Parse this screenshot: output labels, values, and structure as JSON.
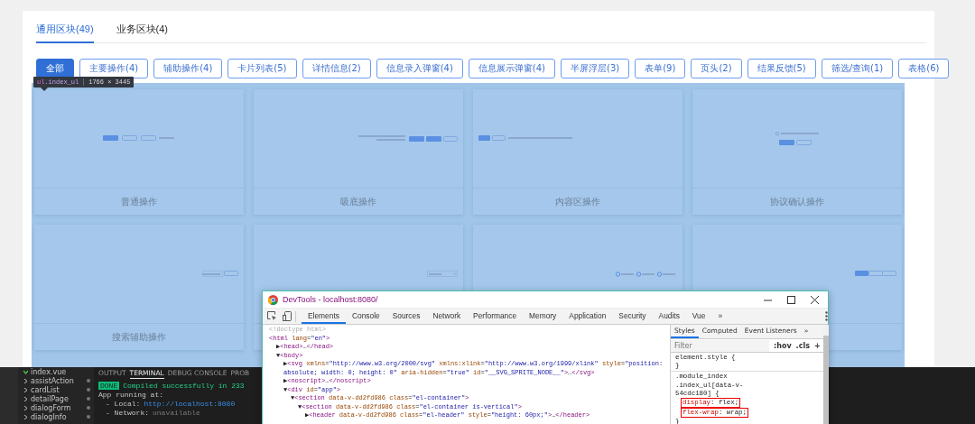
{
  "page_tabs": [
    {
      "label": "通用区块(49)",
      "selected": true
    },
    {
      "label": "业务区块(4)",
      "selected": false
    }
  ],
  "filters": [
    {
      "label": "全部",
      "selected": true
    },
    {
      "label": "主要操作(4)",
      "selected": false
    },
    {
      "label": "辅助操作(4)",
      "selected": false
    },
    {
      "label": "卡片列表(5)",
      "selected": false
    },
    {
      "label": "详情信息(2)",
      "selected": false
    },
    {
      "label": "信息录入弹窗(4)",
      "selected": false
    },
    {
      "label": "信息展示弹窗(4)",
      "selected": false
    },
    {
      "label": "半屏浮层(3)",
      "selected": false
    },
    {
      "label": "表单(9)",
      "selected": false
    },
    {
      "label": "页头(2)",
      "selected": false
    },
    {
      "label": "结果反馈(5)",
      "selected": false
    },
    {
      "label": "筛选/查询(1)",
      "selected": false
    },
    {
      "label": "表格(6)",
      "selected": false
    }
  ],
  "inspect_tooltip": {
    "tag": "ul",
    "class_name": ".index_ul",
    "size": "1766 × 3445"
  },
  "blocks": [
    {
      "kind": "actions",
      "title": "普通操作"
    },
    {
      "kind": "bottom",
      "title": "吸底操作"
    },
    {
      "kind": "inline",
      "title": "内容区操作"
    },
    {
      "kind": "agree",
      "title": "协议确认操作"
    },
    {
      "kind": "search",
      "title": "搜索辅助操作"
    },
    {
      "kind": "select"
    },
    {
      "kind": "radios"
    },
    {
      "kind": "segmented"
    }
  ],
  "editor": {
    "explorer": [
      {
        "kind": "file",
        "label": "index.vue"
      },
      {
        "kind": "folder",
        "label": "assistAction"
      },
      {
        "kind": "folder",
        "label": "cardList"
      },
      {
        "kind": "folder",
        "label": "detailPage"
      },
      {
        "kind": "folder",
        "label": "dialogForm"
      },
      {
        "kind": "folder",
        "label": "dialogInfo"
      }
    ],
    "panel_tabs": [
      {
        "label": "OUTPUT",
        "selected": false
      },
      {
        "label": "TERMINAL",
        "selected": true
      },
      {
        "label": "DEBUG CONSOLE",
        "selected": false
      },
      {
        "label": "PROB",
        "selected": false
      }
    ],
    "terminal": [
      {
        "kind": "badge",
        "badge": "DONE",
        "text": "Compiled successfully in 233"
      },
      {
        "kind": "text",
        "text": "App running at:"
      },
      {
        "kind": "link",
        "label": "- Local:",
        "value": "http://localhost:8080"
      },
      {
        "kind": "muted",
        "label": "- Network:",
        "value": "unavailable"
      }
    ]
  },
  "devtools": {
    "title": "DevTools - localhost:8080/",
    "tabs": [
      {
        "label": "Elements",
        "selected": true
      },
      {
        "label": "Console",
        "selected": false
      },
      {
        "label": "Sources",
        "selected": false
      },
      {
        "label": "Network",
        "selected": false
      },
      {
        "label": "Performance",
        "selected": false
      },
      {
        "label": "Memory",
        "selected": false
      },
      {
        "label": "Application",
        "selected": false
      },
      {
        "label": "Security",
        "selected": false
      },
      {
        "label": "Audits",
        "selected": false
      },
      {
        "label": "Vue",
        "selected": false
      }
    ],
    "more_tabs": "»",
    "dom": [
      {
        "kind": "doctype",
        "text": "<!doctype html>"
      },
      {
        "kind": "element",
        "text": "<html lang=\"en\">",
        "children": [
          {
            "kind": "element",
            "text": "▶<head>…</head>"
          },
          {
            "kind": "element",
            "text": "▼<body>",
            "children": [
              {
                "kind": "element",
                "text": "▶<svg xmlns=\"http://www.w3.org/2000/svg\" xmlns:xlink=\"http://www.w3.org/1999/xlink\" style=\"position: absolute; width: 0; height: 0\" aria-hidden=\"true\" id=\"__SVG_SPRITE_NODE__\">…</svg>"
              },
              {
                "kind": "element",
                "text": "▶<noscript>…</noscript>"
              },
              {
                "kind": "element",
                "text": "▼<div id=\"app\">",
                "children": [
                  {
                    "kind": "element",
                    "text": "▼<section data-v-dd2fd986 class=\"el-container\">",
                    "children": [
                      {
                        "kind": "element",
                        "text": "▼<section data-v-dd2fd986 class=\"el-container is-vertical\">",
                        "children": [
                          {
                            "kind": "element",
                            "text": "▶<header data-v-dd2fd986 class=\"el-header\" style=\"height: 60px;\">…</header>"
                          }
                        ]
                      }
                    ]
                  }
                ]
              }
            ]
          }
        ]
      }
    ],
    "style_tabs": [
      {
        "label": "Styles",
        "selected": true
      },
      {
        "label": "Computed",
        "selected": false
      },
      {
        "label": "Event Listeners",
        "selected": false
      }
    ],
    "style_more": "»",
    "filter": {
      "placeholder": "Filter"
    },
    "style_buttons": [
      ":hov",
      ".cls",
      "+"
    ],
    "style_rules": [
      {
        "selector": "element.style {",
        "close": "}"
      },
      {
        "selector": ".module_index .index_ul[data-v-54cdc180] {",
        "declarations": [
          {
            "property": "display",
            "value": ": flex;",
            "highlighted": true
          },
          {
            "property": "flex-wrap",
            "value": ": wrap;",
            "highlighted": true
          }
        ],
        "close": "}"
      }
    ]
  }
}
